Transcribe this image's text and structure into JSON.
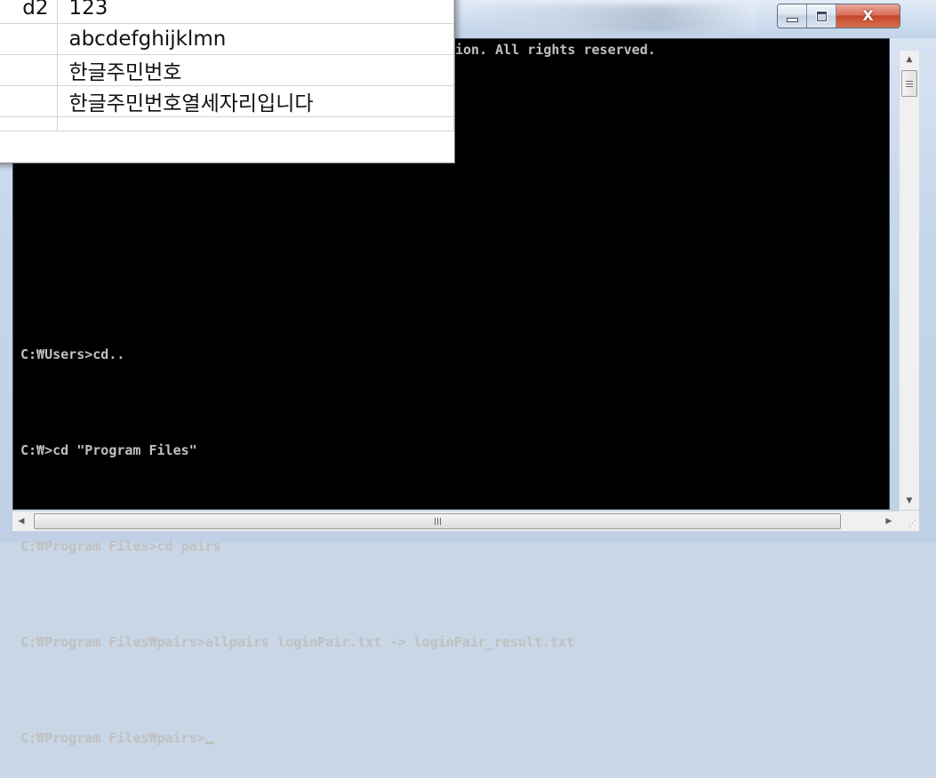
{
  "spreadsheet": {
    "rows": [
      {
        "c1": "d2",
        "c2": "123"
      },
      {
        "c1": "",
        "c2": "abcdefghijklmn"
      },
      {
        "c1": "",
        "c2": "한글주민번호"
      },
      {
        "c1": "",
        "c2": "한글주민번호열세자리입니다"
      },
      {
        "c1": "",
        "c2": ""
      }
    ]
  },
  "console": {
    "copyright_fragment": "ion. All rights reserved.",
    "lines": [
      "C:₩Users>cd..",
      "C:₩>cd \"Program Files\"",
      "C:₩Program Files>cd pairs",
      "C:₩Program Files₩pairs>allpairs loginPair.txt -> loginPair_result.txt",
      "C:₩Program Files₩pairs>"
    ],
    "background": "#000000",
    "text_color": "#c0c0c0"
  },
  "window": {
    "controls": {
      "minimize_icon": "minimize-icon",
      "maximize_icon": "maximize-icon",
      "close_icon": "close-icon",
      "close_glyph": "X"
    },
    "close_color": "#c7472b"
  },
  "scrollbars": {
    "h_grip": "III"
  }
}
